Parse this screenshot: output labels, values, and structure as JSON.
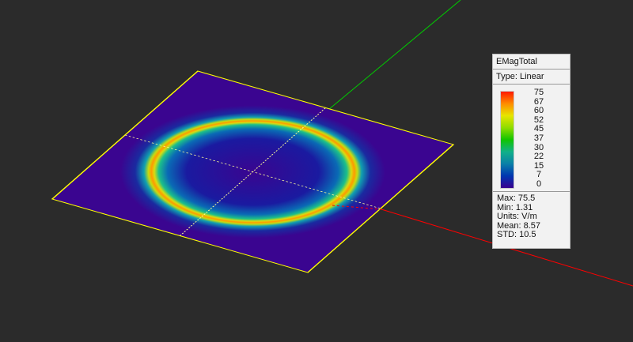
{
  "legend": {
    "title": "EMagTotal",
    "type": "Type: Linear",
    "ticks": [
      "75",
      "67",
      "60",
      "52",
      "45",
      "37",
      "30",
      "22",
      "15",
      "7",
      "0"
    ],
    "stats": [
      "Max: 75.5",
      "Min: 1.31",
      "Units: V/m",
      "Mean: 8.57",
      "STD: 10.5"
    ]
  },
  "colors": {
    "x_axis": "#ff0000",
    "y_axis": "#00cc00",
    "plane_border": "#ffff00",
    "background": "#2b2b2b",
    "field_low": "#3a008f",
    "field_high": "#ff1a00"
  }
}
